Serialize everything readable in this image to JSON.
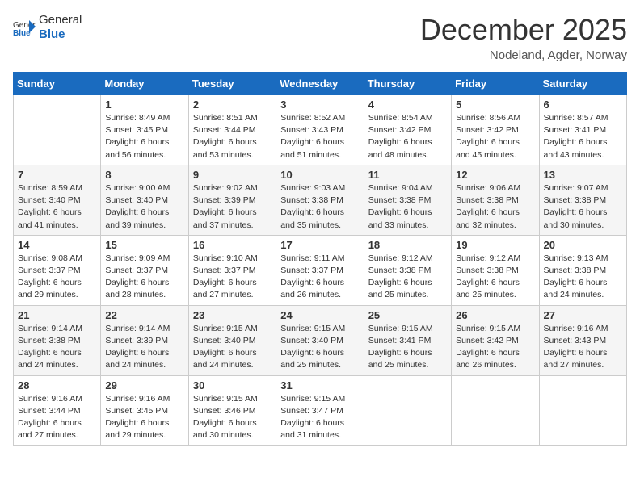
{
  "logo": {
    "text_general": "General",
    "text_blue": "Blue"
  },
  "title": {
    "month_year": "December 2025",
    "location": "Nodeland, Agder, Norway"
  },
  "weekdays": [
    "Sunday",
    "Monday",
    "Tuesday",
    "Wednesday",
    "Thursday",
    "Friday",
    "Saturday"
  ],
  "weeks": [
    [
      {
        "day": "",
        "info": ""
      },
      {
        "day": "1",
        "info": "Sunrise: 8:49 AM\nSunset: 3:45 PM\nDaylight: 6 hours\nand 56 minutes."
      },
      {
        "day": "2",
        "info": "Sunrise: 8:51 AM\nSunset: 3:44 PM\nDaylight: 6 hours\nand 53 minutes."
      },
      {
        "day": "3",
        "info": "Sunrise: 8:52 AM\nSunset: 3:43 PM\nDaylight: 6 hours\nand 51 minutes."
      },
      {
        "day": "4",
        "info": "Sunrise: 8:54 AM\nSunset: 3:42 PM\nDaylight: 6 hours\nand 48 minutes."
      },
      {
        "day": "5",
        "info": "Sunrise: 8:56 AM\nSunset: 3:42 PM\nDaylight: 6 hours\nand 45 minutes."
      },
      {
        "day": "6",
        "info": "Sunrise: 8:57 AM\nSunset: 3:41 PM\nDaylight: 6 hours\nand 43 minutes."
      }
    ],
    [
      {
        "day": "7",
        "info": "Sunrise: 8:59 AM\nSunset: 3:40 PM\nDaylight: 6 hours\nand 41 minutes."
      },
      {
        "day": "8",
        "info": "Sunrise: 9:00 AM\nSunset: 3:40 PM\nDaylight: 6 hours\nand 39 minutes."
      },
      {
        "day": "9",
        "info": "Sunrise: 9:02 AM\nSunset: 3:39 PM\nDaylight: 6 hours\nand 37 minutes."
      },
      {
        "day": "10",
        "info": "Sunrise: 9:03 AM\nSunset: 3:38 PM\nDaylight: 6 hours\nand 35 minutes."
      },
      {
        "day": "11",
        "info": "Sunrise: 9:04 AM\nSunset: 3:38 PM\nDaylight: 6 hours\nand 33 minutes."
      },
      {
        "day": "12",
        "info": "Sunrise: 9:06 AM\nSunset: 3:38 PM\nDaylight: 6 hours\nand 32 minutes."
      },
      {
        "day": "13",
        "info": "Sunrise: 9:07 AM\nSunset: 3:38 PM\nDaylight: 6 hours\nand 30 minutes."
      }
    ],
    [
      {
        "day": "14",
        "info": "Sunrise: 9:08 AM\nSunset: 3:37 PM\nDaylight: 6 hours\nand 29 minutes."
      },
      {
        "day": "15",
        "info": "Sunrise: 9:09 AM\nSunset: 3:37 PM\nDaylight: 6 hours\nand 28 minutes."
      },
      {
        "day": "16",
        "info": "Sunrise: 9:10 AM\nSunset: 3:37 PM\nDaylight: 6 hours\nand 27 minutes."
      },
      {
        "day": "17",
        "info": "Sunrise: 9:11 AM\nSunset: 3:37 PM\nDaylight: 6 hours\nand 26 minutes."
      },
      {
        "day": "18",
        "info": "Sunrise: 9:12 AM\nSunset: 3:38 PM\nDaylight: 6 hours\nand 25 minutes."
      },
      {
        "day": "19",
        "info": "Sunrise: 9:12 AM\nSunset: 3:38 PM\nDaylight: 6 hours\nand 25 minutes."
      },
      {
        "day": "20",
        "info": "Sunrise: 9:13 AM\nSunset: 3:38 PM\nDaylight: 6 hours\nand 24 minutes."
      }
    ],
    [
      {
        "day": "21",
        "info": "Sunrise: 9:14 AM\nSunset: 3:38 PM\nDaylight: 6 hours\nand 24 minutes."
      },
      {
        "day": "22",
        "info": "Sunrise: 9:14 AM\nSunset: 3:39 PM\nDaylight: 6 hours\nand 24 minutes."
      },
      {
        "day": "23",
        "info": "Sunrise: 9:15 AM\nSunset: 3:40 PM\nDaylight: 6 hours\nand 24 minutes."
      },
      {
        "day": "24",
        "info": "Sunrise: 9:15 AM\nSunset: 3:40 PM\nDaylight: 6 hours\nand 25 minutes."
      },
      {
        "day": "25",
        "info": "Sunrise: 9:15 AM\nSunset: 3:41 PM\nDaylight: 6 hours\nand 25 minutes."
      },
      {
        "day": "26",
        "info": "Sunrise: 9:15 AM\nSunset: 3:42 PM\nDaylight: 6 hours\nand 26 minutes."
      },
      {
        "day": "27",
        "info": "Sunrise: 9:16 AM\nSunset: 3:43 PM\nDaylight: 6 hours\nand 27 minutes."
      }
    ],
    [
      {
        "day": "28",
        "info": "Sunrise: 9:16 AM\nSunset: 3:44 PM\nDaylight: 6 hours\nand 27 minutes."
      },
      {
        "day": "29",
        "info": "Sunrise: 9:16 AM\nSunset: 3:45 PM\nDaylight: 6 hours\nand 29 minutes."
      },
      {
        "day": "30",
        "info": "Sunrise: 9:15 AM\nSunset: 3:46 PM\nDaylight: 6 hours\nand 30 minutes."
      },
      {
        "day": "31",
        "info": "Sunrise: 9:15 AM\nSunset: 3:47 PM\nDaylight: 6 hours\nand 31 minutes."
      },
      {
        "day": "",
        "info": ""
      },
      {
        "day": "",
        "info": ""
      },
      {
        "day": "",
        "info": ""
      }
    ]
  ]
}
